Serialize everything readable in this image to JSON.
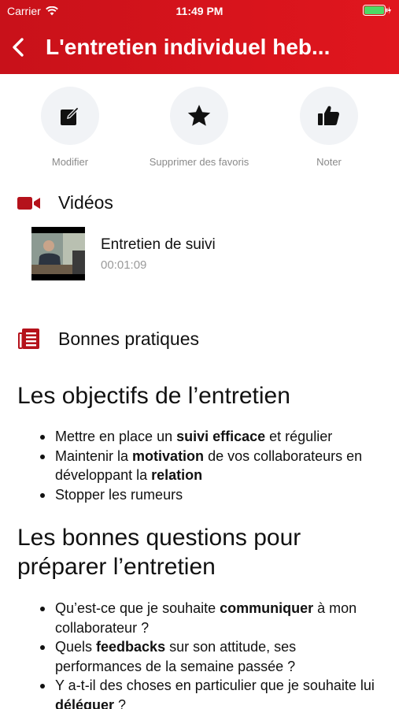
{
  "status_bar": {
    "carrier": "Carrier",
    "time": "11:49 PM"
  },
  "nav": {
    "title": "L'entretien individuel heb..."
  },
  "actions": [
    {
      "label": "Modifier",
      "icon": "edit-icon"
    },
    {
      "label": "Supprimer des favoris",
      "icon": "star-icon"
    },
    {
      "label": "Noter",
      "icon": "thumbs-up-icon"
    }
  ],
  "videos": {
    "title": "Vidéos",
    "items": [
      {
        "title": "Entretien de suivi",
        "duration": "00:01:09"
      }
    ]
  },
  "practices": {
    "title": "Bonnes pratiques"
  },
  "content": {
    "heading1": "Les objectifs de l’entretien",
    "list1": [
      {
        "parts": [
          [
            "Mettre en place un ",
            false
          ],
          [
            "suivi efficace",
            true
          ],
          [
            " et régulier",
            false
          ]
        ]
      },
      {
        "parts": [
          [
            "Maintenir la ",
            false
          ],
          [
            "motivation",
            true
          ],
          [
            " de vos collaborateurs en développant la ",
            false
          ],
          [
            "relation",
            true
          ]
        ]
      },
      {
        "parts": [
          [
            "Stopper les rumeurs",
            false
          ]
        ]
      }
    ],
    "heading2": "Les bonnes questions pour préparer l’entretien",
    "list2": [
      {
        "parts": [
          [
            "Qu’est-ce que je souhaite ",
            false
          ],
          [
            "communiquer",
            true
          ],
          [
            " à mon collaborateur ?",
            false
          ]
        ]
      },
      {
        "parts": [
          [
            "Quels ",
            false
          ],
          [
            "feedbacks",
            true
          ],
          [
            " sur son attitude, ses performances de la semaine passée ?",
            false
          ]
        ]
      },
      {
        "parts": [
          [
            "Y a-t-il des choses en particulier que je souhaite lui ",
            false
          ],
          [
            "déléguer",
            true
          ],
          [
            " ?",
            false
          ]
        ]
      }
    ]
  },
  "colors": {
    "brand_red": "#d8141c",
    "icon_red": "#b5121b"
  }
}
